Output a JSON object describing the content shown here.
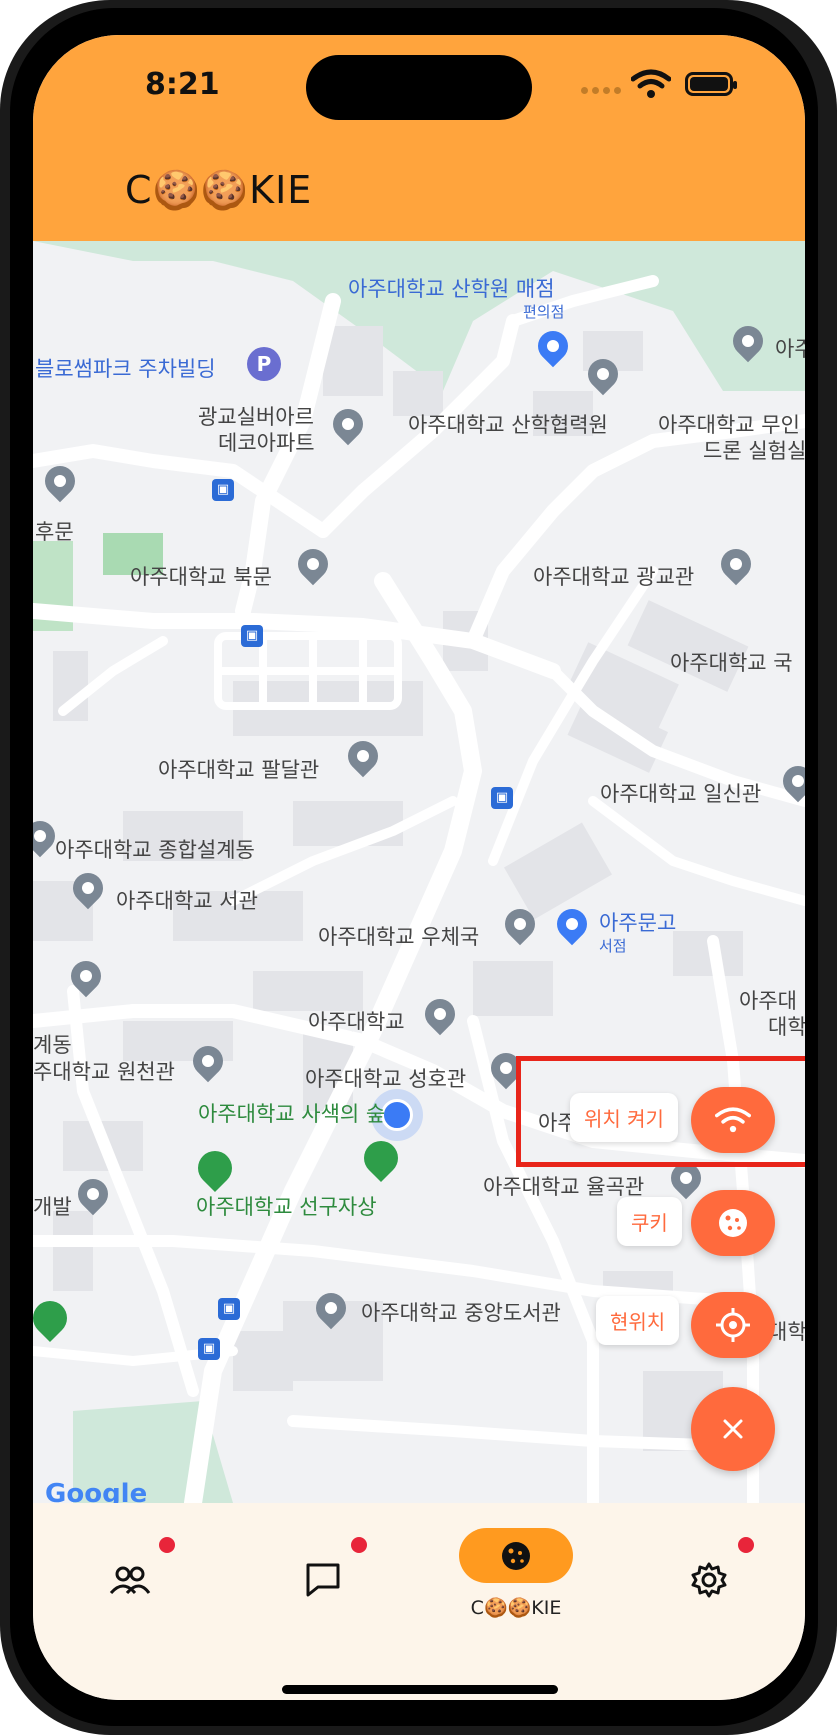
{
  "status_bar": {
    "time": "8:21"
  },
  "header": {
    "title": "C🍪🍪KIE"
  },
  "map": {
    "labels": {
      "l1": "아주대학교 산학원 매점",
      "l1_sub": "편의점",
      "l2": "블로썸파크 주차빌딩",
      "l3a": "광교실버아르",
      "l3b": "데코아파트",
      "l4": "아주대학교 산학협력원",
      "l5a": "아주대학교 무인",
      "l5b": "드론 실험실",
      "l6": "후문",
      "l7": "아주대학교 북문",
      "l8": "아주대학교 광교관",
      "l9": "아주대학교 국",
      "l10": "아주대학교 팔달관",
      "l11": "아주대학교 일신관",
      "l12": "아주대학교 종합설계동",
      "l13": "아주대학교 서관",
      "l14": "아주대학교 우체국",
      "l15a": "아주문고",
      "l15b": "서점",
      "l16": "계동",
      "l17": "아주대학교",
      "l18": "주대학교 원천관",
      "l19": "아주대학교 성호관",
      "l20": "아주대학교 사색의 숲",
      "l21": "아주대학교 국제",
      "l22": "아주대학교 율곡관",
      "l23": "개발",
      "l24": "아주대학교 선구자상",
      "l25": "아주대학교 중앙도서관",
      "l26": "아주대",
      "l27": "대학",
      "l28": "대학",
      "l29": "아주"
    },
    "google": "Google"
  },
  "fab_menu": {
    "location_on_label": "위치 켜기",
    "cookie_label": "쿠키",
    "current_location_label": "현위치"
  },
  "tabbar": {
    "active_label": "C🍪🍪KIE"
  },
  "colors": {
    "header": "#FFA43D",
    "fab": "#FF6A3D",
    "highlight": "#e8251a",
    "tab_active": "#FF9A1F",
    "badge": "#e8253a"
  }
}
